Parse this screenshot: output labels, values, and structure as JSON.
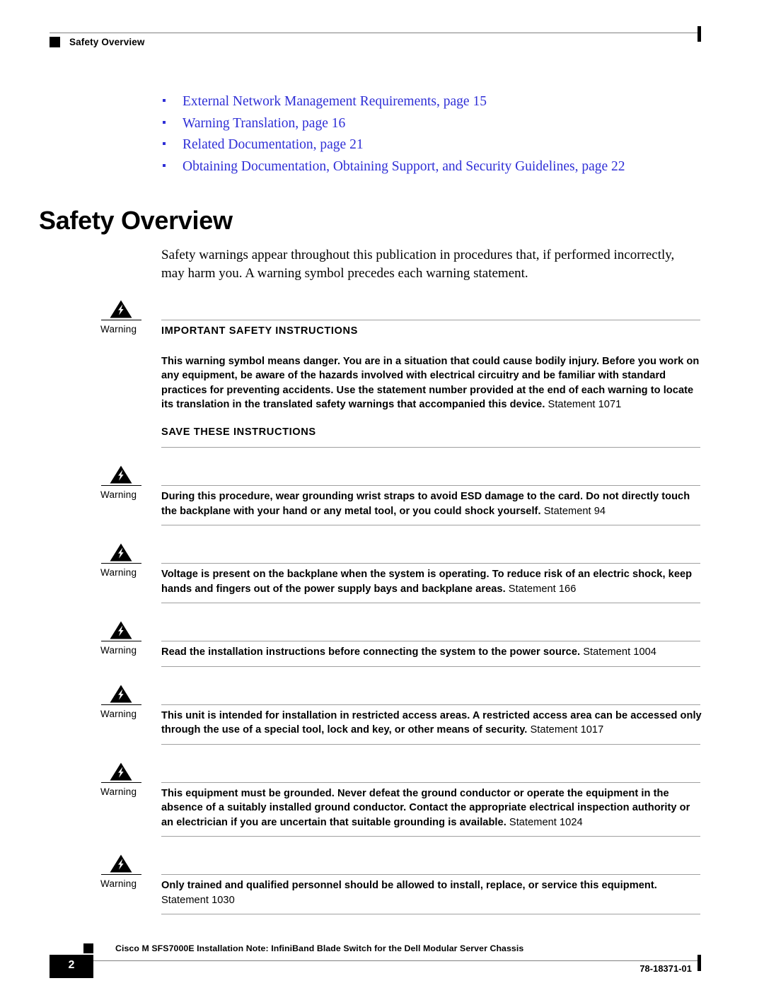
{
  "header": {
    "running_head": "Safety Overview",
    "marker_icon": "black-square-marker"
  },
  "xrefs": {
    "link_color": "#2f2fd6",
    "items": [
      {
        "label": "External Network Management Requirements, page 15"
      },
      {
        "label": "Warning Translation, page 16"
      },
      {
        "label": "Related Documentation, page 21"
      },
      {
        "label": "Obtaining Documentation, Obtaining Support, and Security Guidelines, page 22"
      }
    ]
  },
  "main": {
    "title": "Safety Overview",
    "intro": "Safety warnings appear throughout this publication in procedures that, if performed incorrectly, may harm you. A warning symbol precedes each warning statement."
  },
  "warnings": {
    "label": "Warning",
    "icon": "warning-triangle-lightning-icon",
    "items": [
      {
        "heading": "IMPORTANT SAFETY INSTRUCTIONS",
        "bold_text": "This warning symbol means danger. You are in a situation that could cause bodily injury. Before you work on any equipment, be aware of the hazards involved with electrical circuitry and be familiar with standard practices for preventing accidents. Use the statement number provided at the end of each warning to locate its translation in the translated safety warnings that accompanied this device.",
        "statement": "Statement 1071",
        "footer_text": "SAVE THESE INSTRUCTIONS"
      },
      {
        "bold_text": "During this procedure, wear grounding wrist straps to avoid ESD damage to the card. Do not directly touch the backplane with your hand or any metal tool, or you could shock yourself.",
        "statement": "Statement 94"
      },
      {
        "bold_text": "Voltage is present on the backplane when the system is operating. To reduce risk of an electric shock, keep hands and fingers out of the power supply bays and backplane areas.",
        "statement": "Statement 166"
      },
      {
        "bold_text": "Read the installation instructions before connecting the system to the power source.",
        "statement": "Statement 1004"
      },
      {
        "bold_text": "This unit is intended for installation in restricted access areas. A restricted access area can be accessed only through the use of a special tool, lock and key, or other means of security.",
        "statement": "Statement 1017"
      },
      {
        "bold_text": "This equipment must be grounded. Never defeat the ground conductor or operate the equipment in the absence of a suitably installed ground conductor. Contact the appropriate electrical inspection authority or an electrician if you are uncertain that suitable grounding is available.",
        "statement": "Statement 1024"
      },
      {
        "bold_text": "Only trained and qualified personnel should be allowed to install, replace, or service this equipment.",
        "statement": "Statement 1030"
      }
    ]
  },
  "footer": {
    "page_number": "2",
    "doc_title": "Cisco M SFS7000E Installation Note: InfiniBand Blade Switch for the Dell Modular Server Chassis",
    "part_number": "78-18371-01",
    "marker_icon": "black-square-marker"
  }
}
